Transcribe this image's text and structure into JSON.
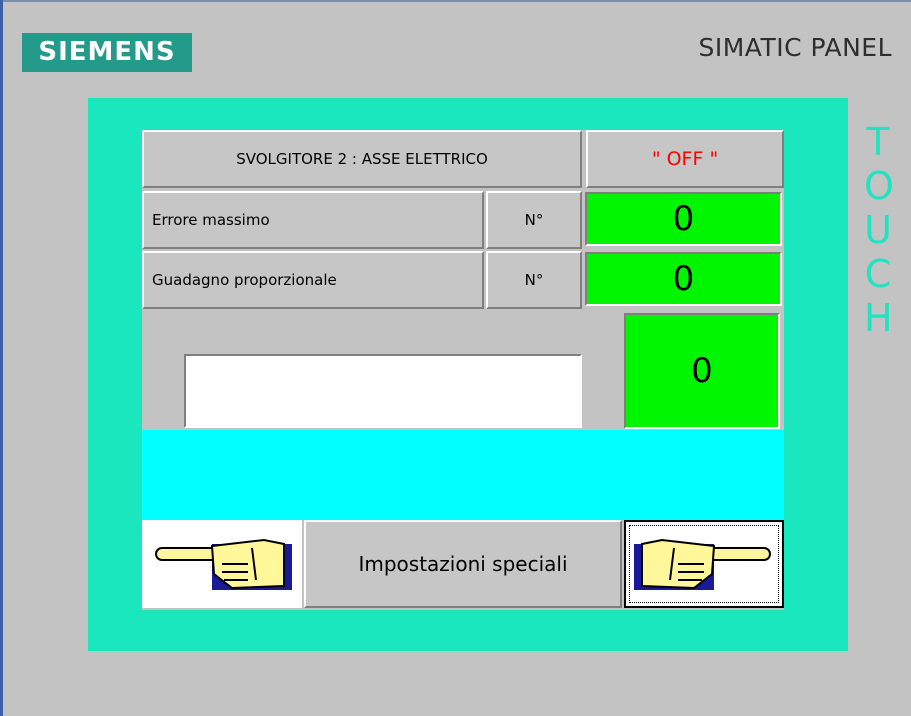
{
  "header": {
    "brand": "SIEMENS",
    "model": "SIMATIC PANEL",
    "touch_label": [
      "T",
      "O",
      "U",
      "C",
      "H"
    ]
  },
  "screen": {
    "title": "SVOLGITORE 2 : ASSE ELETTRICO",
    "status": "\" OFF \"",
    "rows": [
      {
        "label": "Errore massimo",
        "unit": "N°",
        "value": "0"
      },
      {
        "label": "Guadagno proporzionale",
        "unit": "N°",
        "value": "0"
      }
    ],
    "input_value": "",
    "big_value": "0",
    "alarm_text": "",
    "nav": {
      "left_icon": "hand-pointing-left-icon",
      "center_label": "Impostazioni speciali",
      "right_icon": "hand-pointing-right-icon"
    }
  },
  "colors": {
    "bezel": "#1be7bf",
    "screen_bg": "#c3c3c3",
    "value_bg": "#00f600",
    "alarm_bar": "#00ffff",
    "status_text": "#ff0000",
    "brand_bg": "#239a8a"
  }
}
